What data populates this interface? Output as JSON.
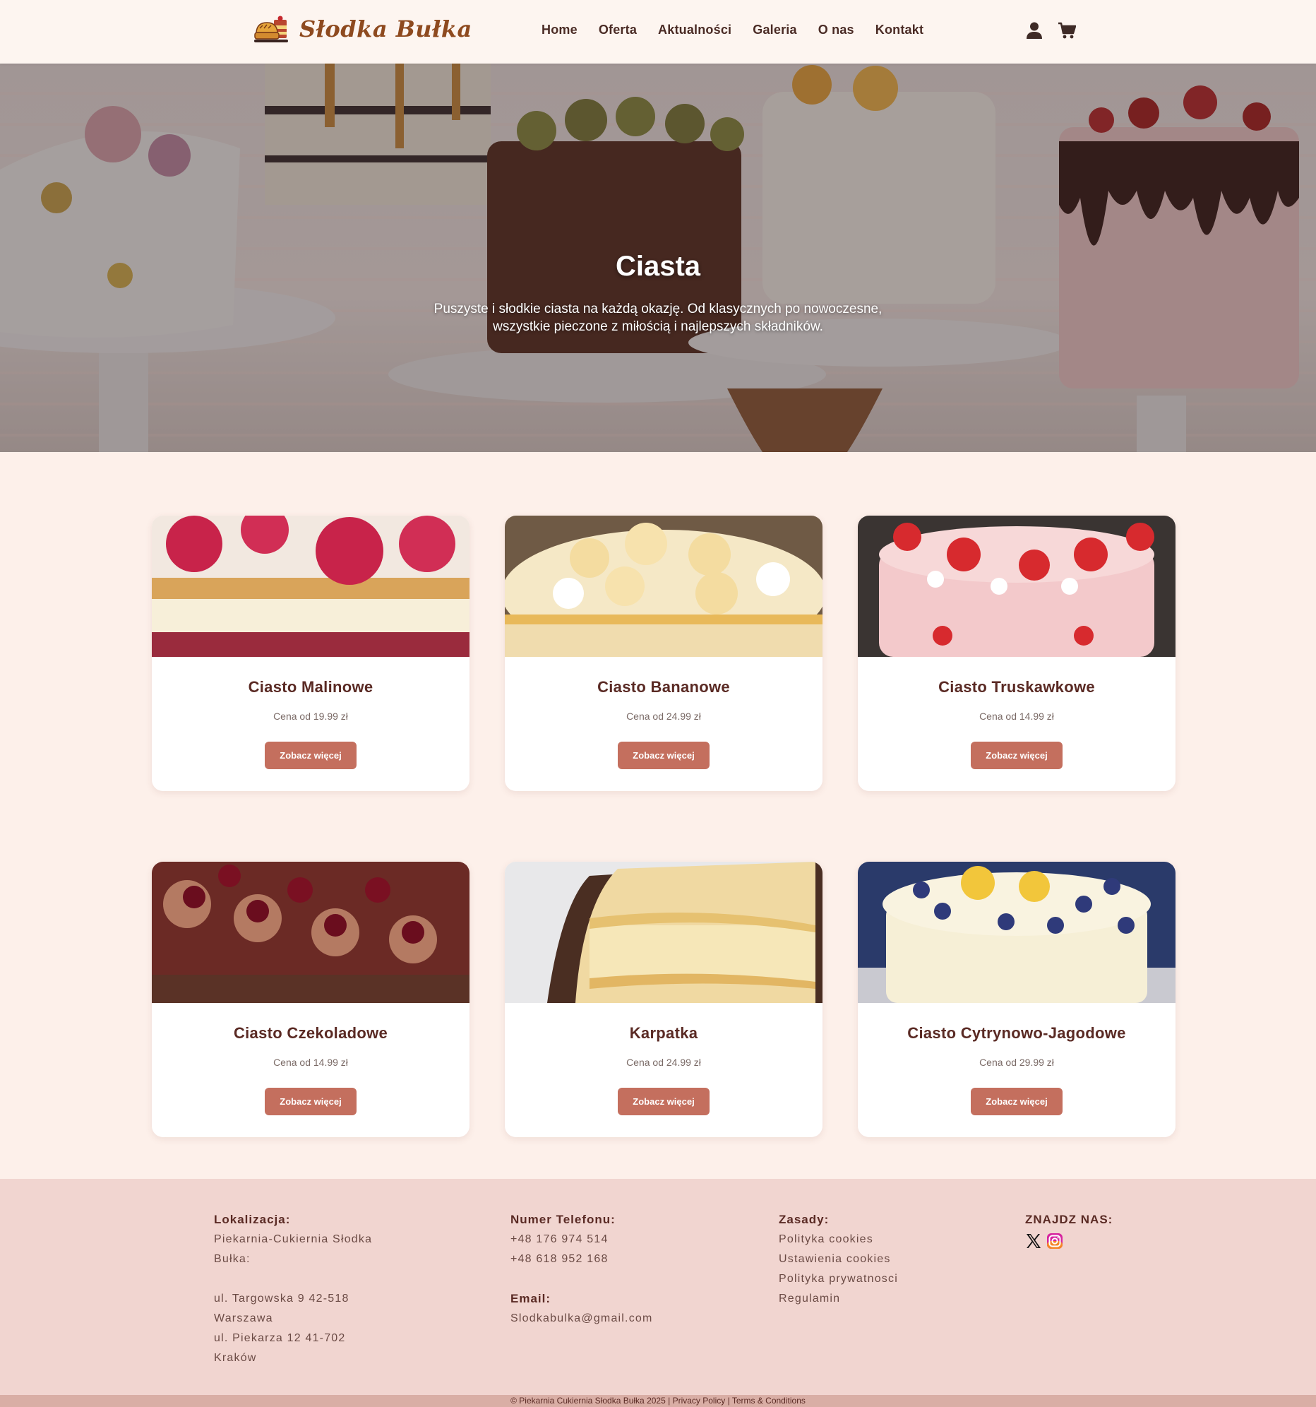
{
  "header": {
    "logo_text": "Słodka Bułka",
    "logo_icon": "bakery-logo-icon",
    "nav": [
      {
        "label": "Home"
      },
      {
        "label": "Oferta"
      },
      {
        "label": "Aktualności"
      },
      {
        "label": "Galeria"
      },
      {
        "label": "O nas"
      },
      {
        "label": "Kontakt"
      }
    ],
    "icons": [
      "user-icon",
      "cart-icon"
    ]
  },
  "hero": {
    "title": "Ciasta",
    "description": "Puszyste i słodkie ciasta na każdą okazję. Od klasycznych po nowoczesne, wszystkie pieczone z miłością i najlepszych składników."
  },
  "products": [
    {
      "name": "Ciasto Malinowe",
      "price": "Cena od 19.99 zł",
      "button": "Zobacz więcej",
      "image": "raspberry-cake-image"
    },
    {
      "name": "Ciasto Bananowe",
      "price": "Cena od 24.99 zł",
      "button": "Zobacz więcej",
      "image": "banana-cake-image"
    },
    {
      "name": "Ciasto Truskawkowe",
      "price": "Cena od 14.99 zł",
      "button": "Zobacz więcej",
      "image": "strawberry-cake-image"
    },
    {
      "name": "Ciasto Czekoladowe",
      "price": "Cena od 14.99 zł",
      "button": "Zobacz więcej",
      "image": "chocolate-cake-image"
    },
    {
      "name": "Karpatka",
      "price": "Cena od 24.99 zł",
      "button": "Zobacz więcej",
      "image": "karpatka-image"
    },
    {
      "name": "Ciasto Cytrynowo-Jagodowe",
      "price": "Cena od 29.99 zł",
      "button": "Zobacz więcej",
      "image": "lemon-blueberry-cake-image"
    }
  ],
  "footer": {
    "location": {
      "heading": "Lokalizacja:",
      "name_line1": "Piekarnia-Cukiernia Słodka",
      "name_line2": "Bułka:",
      "addr1_street": "ul. Targowska 9 42-518",
      "addr1_city": "Warszawa",
      "addr2_street": "ul. Piekarza 12 41-702",
      "addr2_city": "Kraków"
    },
    "phone": {
      "heading": "Numer Telefonu:",
      "numbers": [
        "+48 176 974 514",
        "+48 618 952 168"
      ]
    },
    "email": {
      "heading": "Email:",
      "address": "Slodkabulka@gmail.com"
    },
    "rules": {
      "heading": "Zasady:",
      "links": [
        "Polityka cookies",
        "Ustawienia cookies",
        "Polityka prywatnosci",
        "Regulamin"
      ]
    },
    "social": {
      "heading": "ZNAJDZ NAS:",
      "icons": [
        "x-twitter-icon",
        "instagram-icon"
      ]
    },
    "bottom": {
      "copyright": "© Piekarnia Cukiernia Słodka Bułka 2025",
      "sep1": " | ",
      "privacy": "Privacy Policy",
      "sep2": " | ",
      "terms": "Terms & Conditions"
    }
  },
  "colors": {
    "page_bg": "#fdf0ea",
    "header_bg": "#fdf5f0",
    "footer_bg": "#f1d5d0",
    "bottom_bar_bg": "#d9aea5",
    "button": "#c46f5e",
    "text_dark": "#5a2a24",
    "logo": "#8e4a1f"
  }
}
